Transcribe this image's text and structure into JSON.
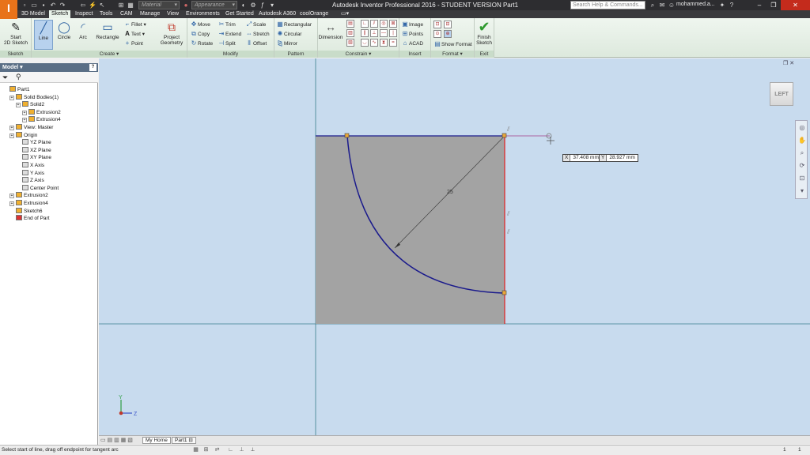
{
  "titlebar": {
    "logo": "I",
    "logo_sub": "PRO",
    "material": "Material",
    "appearance": "Appearance",
    "title": "Autodesk Inventor Professional 2016 - STUDENT VERSION    Part1",
    "search_placeholder": "Search Help & Commands...",
    "user": "mohammed.a..."
  },
  "tabs": [
    "3D Model",
    "Sketch",
    "Inspect",
    "Tools",
    "CAM",
    "Manage",
    "View",
    "Environments",
    "Get Started",
    "Autodesk A360",
    "coolOrange"
  ],
  "ribbon": {
    "sketch_panel": {
      "title": "Sketch",
      "start_label_1": "Start",
      "start_label_2": "2D Sketch"
    },
    "create_panel": {
      "title": "Create",
      "line": "Line",
      "circle": "Circle",
      "arc": "Arc",
      "rectangle": "Rectangle",
      "fillet": "Fillet",
      "text": "Text",
      "point": "Point",
      "project_1": "Project",
      "project_2": "Geometry"
    },
    "modify_panel": {
      "title": "Modify",
      "move": "Move",
      "copy": "Copy",
      "rotate": "Rotate",
      "trim": "Trim",
      "extend": "Extend",
      "split": "Split",
      "scale": "Scale",
      "stretch": "Stretch",
      "offset": "Offset"
    },
    "pattern_panel": {
      "title": "Pattern",
      "rectangular": "Rectangular",
      "circular": "Circular",
      "mirror": "Mirror"
    },
    "constrain_panel": {
      "title": "Constrain",
      "dimension": "Dimension"
    },
    "insert_panel": {
      "title": "Insert",
      "image": "Image",
      "points": "Points",
      "acad": "ACAD"
    },
    "format_panel": {
      "title": "Format",
      "show_format": "Show Format"
    },
    "exit_panel": {
      "title": "Exit",
      "finish_1": "Finish",
      "finish_2": "Sketch"
    }
  },
  "browser": {
    "title": "Model",
    "tree": [
      {
        "label": "Part1",
        "indent": 0
      },
      {
        "label": "Solid Bodies(1)",
        "indent": 1
      },
      {
        "label": "Solid2",
        "indent": 2
      },
      {
        "label": "Extrusion2",
        "indent": 3
      },
      {
        "label": "Extrusion4",
        "indent": 3
      },
      {
        "label": "View: Master",
        "indent": 1
      },
      {
        "label": "Origin",
        "indent": 1
      },
      {
        "label": "YZ Plane",
        "indent": 2
      },
      {
        "label": "XZ Plane",
        "indent": 2
      },
      {
        "label": "XY Plane",
        "indent": 2
      },
      {
        "label": "X Axis",
        "indent": 2
      },
      {
        "label": "Y Axis",
        "indent": 2
      },
      {
        "label": "Z Axis",
        "indent": 2
      },
      {
        "label": "Center Point",
        "indent": 2
      },
      {
        "label": "Extrusion2",
        "indent": 1
      },
      {
        "label": "Extrusion4",
        "indent": 1
      },
      {
        "label": "Sketch6",
        "indent": 1
      },
      {
        "label": "End of Part",
        "indent": 1
      }
    ]
  },
  "canvas": {
    "viewcube": "LEFT",
    "dimension": "25",
    "x_label": "X",
    "x_value": "37.408 mm",
    "y_label": "Y",
    "y_value": "28.927 mm",
    "axis_y": "Y",
    "axis_z": "Z"
  },
  "doctabs": {
    "home": "My Home",
    "part": "Part1"
  },
  "status": {
    "message": "Select start of line, drag off endpoint for tangent arc",
    "num1": "1",
    "num2": "1"
  },
  "colors": {
    "canvas_bg": "#c8dbee",
    "face": "#a3a3a3",
    "arc": "#1a1a8c",
    "edge_red": "#e02020",
    "accent_orange": "#e8731a"
  }
}
